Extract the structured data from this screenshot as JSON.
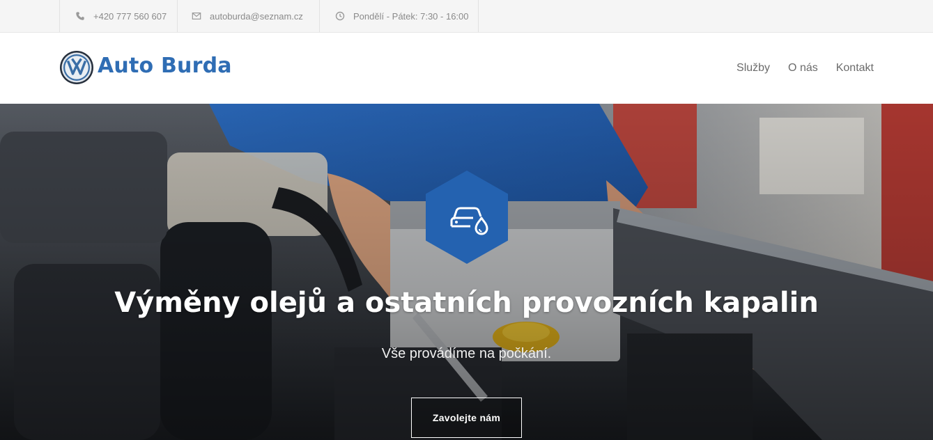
{
  "topbar": {
    "phone": "+420 777 560 607",
    "email": "autoburda@seznam.cz",
    "hours": "Pondělí - Pátek: 7:30 - 16:00",
    "icons": [
      "phone-icon",
      "envelope-icon",
      "clock-icon"
    ]
  },
  "header": {
    "brand": "Auto Burda",
    "logo_icon": "vw-logo",
    "nav": [
      "Služby",
      "O nás",
      "Kontakt"
    ]
  },
  "hero": {
    "icon": "car-oil-drop-icon",
    "title": "Výměny olejů a ostatních provozních kapalin",
    "subtitle": "Vše provádíme na počkání.",
    "cta_label": "Zavolejte nám"
  },
  "colors": {
    "brand_blue": "#2f6db4",
    "hex_blue": "#2462b0",
    "topbar_bg": "#f5f5f5",
    "text_gray": "#8a8a8a"
  }
}
